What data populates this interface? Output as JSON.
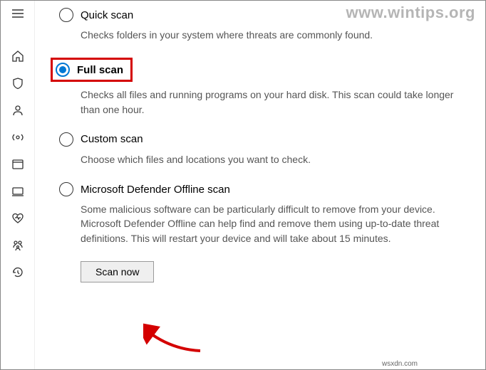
{
  "watermark": "www.wintips.org",
  "watermark_small": "wsxdn.com",
  "options": {
    "quick": {
      "label": "Quick scan",
      "desc": "Checks folders in your system where threats are commonly found."
    },
    "full": {
      "label": "Full scan",
      "desc": "Checks all files and running programs on your hard disk. This scan could take longer than one hour."
    },
    "custom": {
      "label": "Custom scan",
      "desc": "Choose which files and locations you want to check."
    },
    "offline": {
      "label": "Microsoft Defender Offline scan",
      "desc": "Some malicious software can be particularly difficult to remove from your device. Microsoft Defender Offline can help find and remove them using up-to-date threat definitions. This will restart your device and will take about 15 minutes."
    }
  },
  "buttons": {
    "scan_now": "Scan now"
  }
}
